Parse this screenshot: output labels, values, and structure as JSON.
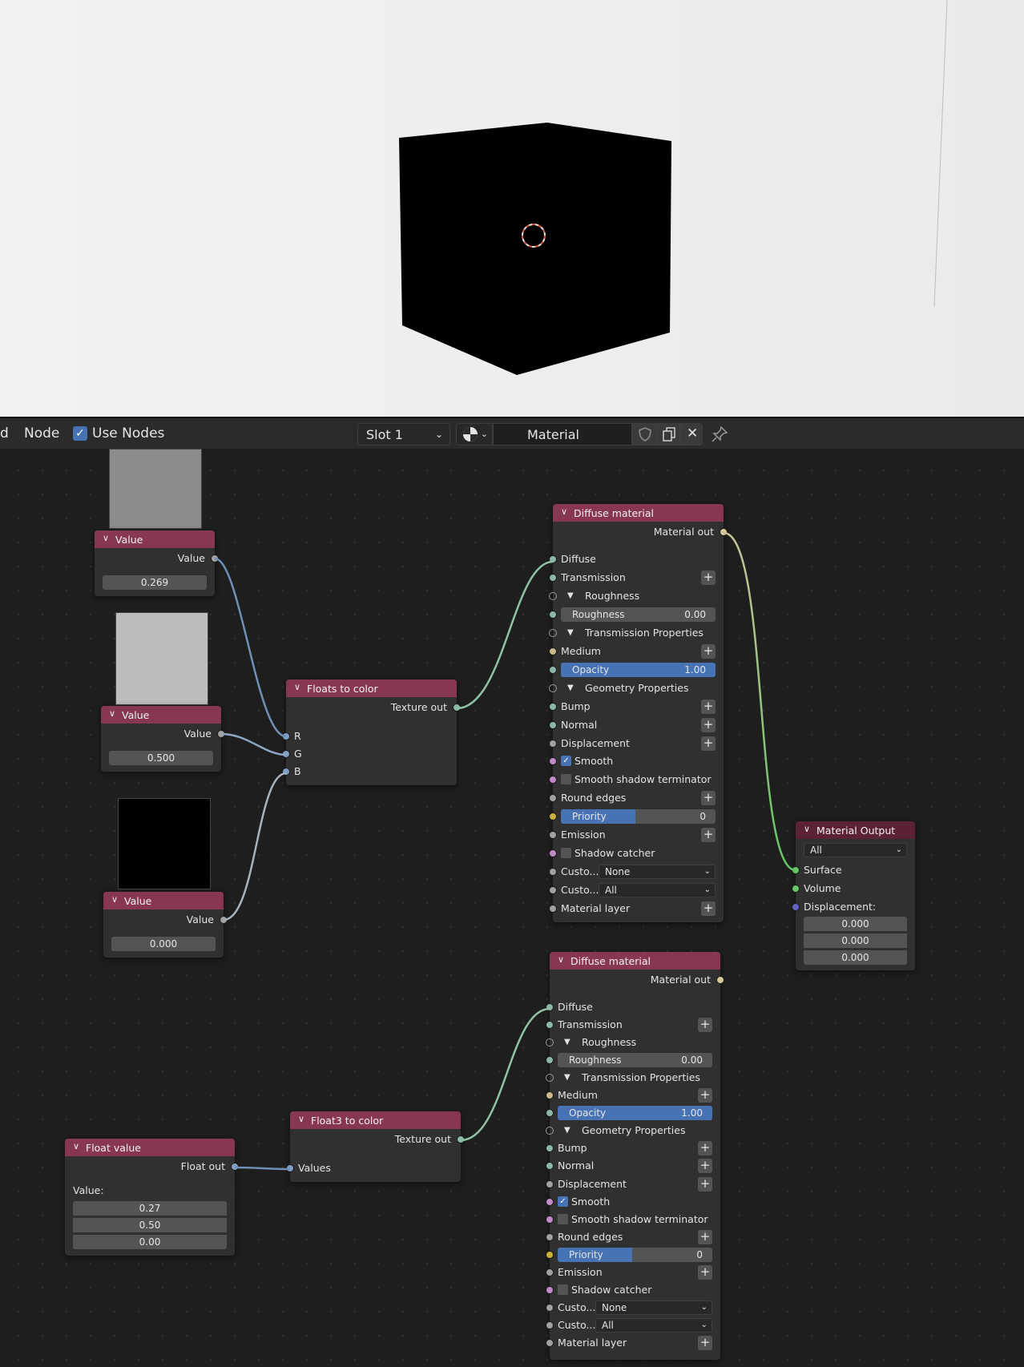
{
  "header": {
    "view_menu_clipped": "d",
    "node_menu": "Node",
    "use_nodes_label": "Use Nodes",
    "use_nodes_checked": true,
    "slot_label": "Slot 1",
    "material_name": "Material"
  },
  "value_nodes": [
    {
      "title": "Value",
      "output_label": "Value",
      "value": "0.269",
      "preview_color": "#8c8c8c"
    },
    {
      "title": "Value",
      "output_label": "Value",
      "value": "0.500",
      "preview_color": "#bcbcbc"
    },
    {
      "title": "Value",
      "output_label": "Value",
      "value": "0.000",
      "preview_color": "#000000"
    }
  ],
  "floats_to_color": {
    "title": "Floats to color",
    "output_label": "Texture out",
    "inputs": [
      "R",
      "G",
      "B"
    ]
  },
  "float_value": {
    "title": "Float value",
    "output_label": "Float out",
    "value_label": "Value:",
    "values": [
      "0.27",
      "0.50",
      "0.00"
    ]
  },
  "float3_to_color": {
    "title": "Float3 to color",
    "output_label": "Texture out",
    "input_label": "Values"
  },
  "diffuse": {
    "title": "Diffuse material",
    "output_label": "Material out",
    "diffuse": "Diffuse",
    "transmission": "Transmission",
    "roughness_group": "Roughness",
    "roughness_label": "Roughness",
    "roughness_value": "0.00",
    "transmission_props": "Transmission Properties",
    "medium": "Medium",
    "opacity_label": "Opacity",
    "opacity_value": "1.00",
    "opacity_fraction": 1.0,
    "geometry_props": "Geometry Properties",
    "bump": "Bump",
    "normal": "Normal",
    "displacement": "Displacement",
    "smooth": "Smooth",
    "smooth_checked": true,
    "smooth_shadow": "Smooth shadow terminator",
    "round_edges": "Round edges",
    "priority_label": "Priority",
    "priority_value": "0",
    "priority_fraction": 0.48,
    "emission": "Emission",
    "shadow_catcher": "Shadow catcher",
    "custom_aov_label": "Custo...",
    "custom_aov_value": "None",
    "custom_mask_label": "Custo...",
    "custom_mask_value": "All",
    "material_layer": "Material layer"
  },
  "material_output": {
    "title": "Material Output",
    "target": "All",
    "surface": "Surface",
    "volume": "Volume",
    "displacement": "Displacement:",
    "disp_values": [
      "0.000",
      "0.000",
      "0.000"
    ]
  },
  "colors": {
    "node_header": "#883750",
    "accent_blue": "#4772b3",
    "socket_float": "#a1a1a1",
    "socket_texture": "#8cb6a8",
    "socket_material": "#d4c79a",
    "socket_octane": "#c28ac6",
    "socket_int": "#c9b23c",
    "socket_shader": "#63c763",
    "socket_vector": "#6363c7",
    "wire_blue": "#6f8fb4",
    "wire_float": "#b0b0b0",
    "wire_teal": "#8fc2a6",
    "wire_material": "#c8c39a",
    "wire_shader": "#62c462"
  }
}
